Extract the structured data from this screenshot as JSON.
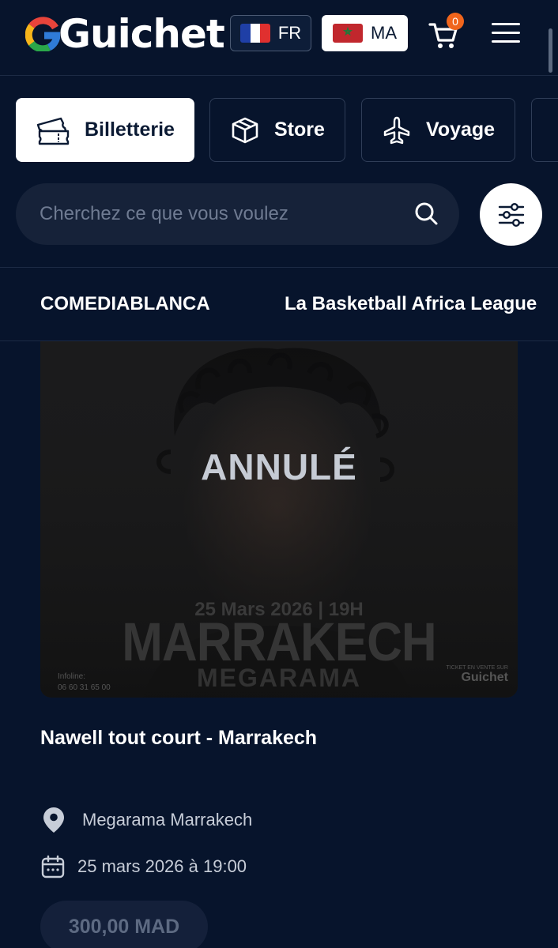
{
  "header": {
    "logo_text": "Guichet",
    "language_button": "FR",
    "country_button": "MA",
    "cart_count": "0"
  },
  "categories": [
    {
      "label": "Billetterie",
      "icon": "ticket-icon",
      "active": true
    },
    {
      "label": "Store",
      "icon": "box-icon",
      "active": false
    },
    {
      "label": "Voyage",
      "icon": "plane-icon",
      "active": false
    }
  ],
  "search": {
    "placeholder": "Cherchez ce que vous voulez"
  },
  "featured": [
    "COMEDIABLANCA",
    "La Basketball Africa League"
  ],
  "event": {
    "status_label": "ANNULÉ",
    "poster": {
      "date_text": "25 Mars 2026 | 19H",
      "city": "MARRAKECH",
      "venue": "MEGARAMA",
      "infoline_label": "Infoline:",
      "infoline_number": "06 60 31 65 00",
      "brand_caption": "TICKET EN VENTE SUR",
      "brand": "Guichet"
    },
    "title": "Nawell tout court - Marrakech",
    "venue": "Megarama Marrakech",
    "date": "25 mars 2026 à 19:00",
    "price": "300,00 MAD"
  },
  "colors": {
    "background": "#07142c",
    "cart_badge": "#f0651c",
    "surface": "#162239"
  }
}
